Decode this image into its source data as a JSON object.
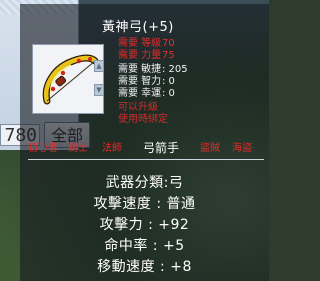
{
  "background": {
    "ui_color": "#c3d1e0"
  },
  "behind_window": {
    "number_box_value": "780",
    "all_button_label": "全部"
  },
  "item": {
    "name": "黃神弓(+5)",
    "icon": "golden-bow-icon",
    "requirements_red": [
      {
        "label": "需要 等級",
        "value": "70"
      },
      {
        "label": "需要 力量",
        "value": "75"
      }
    ],
    "requirements_white": [
      {
        "label": "需要 敏捷",
        "value": ": 205"
      },
      {
        "label": "需要 智力",
        "value": ": 0"
      },
      {
        "label": "需要 幸運",
        "value": ": 0"
      }
    ],
    "extra_red_lines": [
      "可以升級",
      "使用時綁定"
    ],
    "classes": [
      {
        "name": "初心者",
        "active": false
      },
      {
        "name": "劍士",
        "active": false
      },
      {
        "name": "法師",
        "active": false
      },
      {
        "name": "弓箭手",
        "active": true
      },
      {
        "name": "盜賊",
        "active": false
      },
      {
        "name": "海盜",
        "active": false
      }
    ],
    "stats": [
      "武器分類:弓",
      "攻擊速度 : 普通",
      "攻擊力 : +92",
      "命中率 : +5",
      "移動速度 : +8"
    ]
  },
  "colors": {
    "requirement_unmet": "#e22d2d",
    "text": "#ffffff"
  }
}
